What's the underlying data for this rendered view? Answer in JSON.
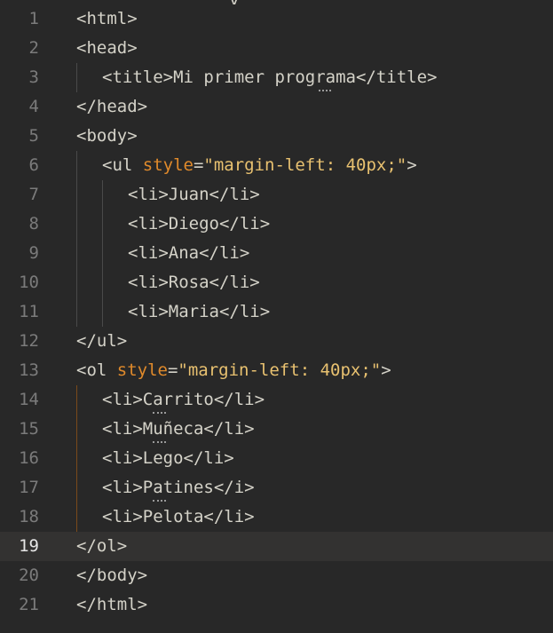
{
  "editor": {
    "top_clip_text": "y",
    "lines": [
      {
        "no": "1",
        "parts": [
          {
            "t": "<html>",
            "c": "tag"
          }
        ]
      },
      {
        "no": "2",
        "parts": [
          {
            "t": "<head>",
            "c": "tag"
          }
        ]
      },
      {
        "no": "3",
        "parts": [
          {
            "t": "<title>",
            "c": "tag"
          },
          {
            "t": "Mi primer programa",
            "c": "txt"
          },
          {
            "t": "</title>",
            "c": "tag"
          }
        ]
      },
      {
        "no": "4",
        "parts": [
          {
            "t": "</head>",
            "c": "tag"
          }
        ]
      },
      {
        "no": "5",
        "parts": [
          {
            "t": "<body>",
            "c": "tag"
          }
        ]
      },
      {
        "no": "6",
        "parts": [
          {
            "t": "<ul ",
            "c": "tag"
          },
          {
            "t": "style",
            "c": "attr"
          },
          {
            "t": "=",
            "c": "tag"
          },
          {
            "t": "\"margin-left: 40px;\"",
            "c": "str"
          },
          {
            "t": ">",
            "c": "tag"
          }
        ]
      },
      {
        "no": "7",
        "parts": [
          {
            "t": "<li>",
            "c": "tag"
          },
          {
            "t": "Juan",
            "c": "txt"
          },
          {
            "t": "</li>",
            "c": "tag"
          }
        ]
      },
      {
        "no": "8",
        "parts": [
          {
            "t": "<li>",
            "c": "tag"
          },
          {
            "t": "Diego",
            "c": "txt"
          },
          {
            "t": "</li>",
            "c": "tag"
          }
        ]
      },
      {
        "no": "9",
        "parts": [
          {
            "t": "<li>",
            "c": "tag"
          },
          {
            "t": "Ana",
            "c": "txt"
          },
          {
            "t": "</li>",
            "c": "tag"
          }
        ]
      },
      {
        "no": "10",
        "parts": [
          {
            "t": "<li>",
            "c": "tag"
          },
          {
            "t": "Rosa",
            "c": "txt"
          },
          {
            "t": "</li>",
            "c": "tag"
          }
        ]
      },
      {
        "no": "11",
        "parts": [
          {
            "t": "<li>",
            "c": "tag"
          },
          {
            "t": "Maria",
            "c": "txt"
          },
          {
            "t": "</li>",
            "c": "tag"
          }
        ]
      },
      {
        "no": "12",
        "parts": [
          {
            "t": "</ul>",
            "c": "tag"
          }
        ]
      },
      {
        "no": "13",
        "parts": [
          {
            "t": "<ol ",
            "c": "tag"
          },
          {
            "t": "style",
            "c": "attr"
          },
          {
            "t": "=",
            "c": "tag"
          },
          {
            "t": "\"margin-left: 40px;\"",
            "c": "str"
          },
          {
            "t": ">",
            "c": "tag"
          }
        ]
      },
      {
        "no": "14",
        "parts": [
          {
            "t": "<li>",
            "c": "tag"
          },
          {
            "t": "Carrito",
            "c": "txt"
          },
          {
            "t": "</li>",
            "c": "tag"
          }
        ]
      },
      {
        "no": "15",
        "parts": [
          {
            "t": "<li>",
            "c": "tag"
          },
          {
            "t": "Muñeca",
            "c": "txt"
          },
          {
            "t": "</li>",
            "c": "tag"
          }
        ]
      },
      {
        "no": "16",
        "parts": [
          {
            "t": "<li>",
            "c": "tag"
          },
          {
            "t": "Lego",
            "c": "txt"
          },
          {
            "t": "</li>",
            "c": "tag"
          }
        ]
      },
      {
        "no": "17",
        "parts": [
          {
            "t": "<li>",
            "c": "tag"
          },
          {
            "t": "Patines",
            "c": "txt"
          },
          {
            "t": "</i>",
            "c": "tag"
          }
        ]
      },
      {
        "no": "18",
        "parts": [
          {
            "t": "<li>",
            "c": "tag"
          },
          {
            "t": "Pelota",
            "c": "txt"
          },
          {
            "t": "</li>",
            "c": "tag"
          }
        ]
      },
      {
        "no": "19",
        "parts": [
          {
            "t": "</ol>",
            "c": "tag"
          }
        ],
        "active": true
      },
      {
        "no": "20",
        "parts": [
          {
            "t": "</body>",
            "c": "tag"
          }
        ]
      },
      {
        "no": "21",
        "parts": [
          {
            "t": "</html>",
            "c": "tag"
          }
        ]
      }
    ],
    "colors": {
      "background": "#282828",
      "active_line": "#333231",
      "tag": "#d4d2c8",
      "attribute": "#e08a2b",
      "string": "#e8c170",
      "line_number": "#7b7b7b"
    }
  }
}
